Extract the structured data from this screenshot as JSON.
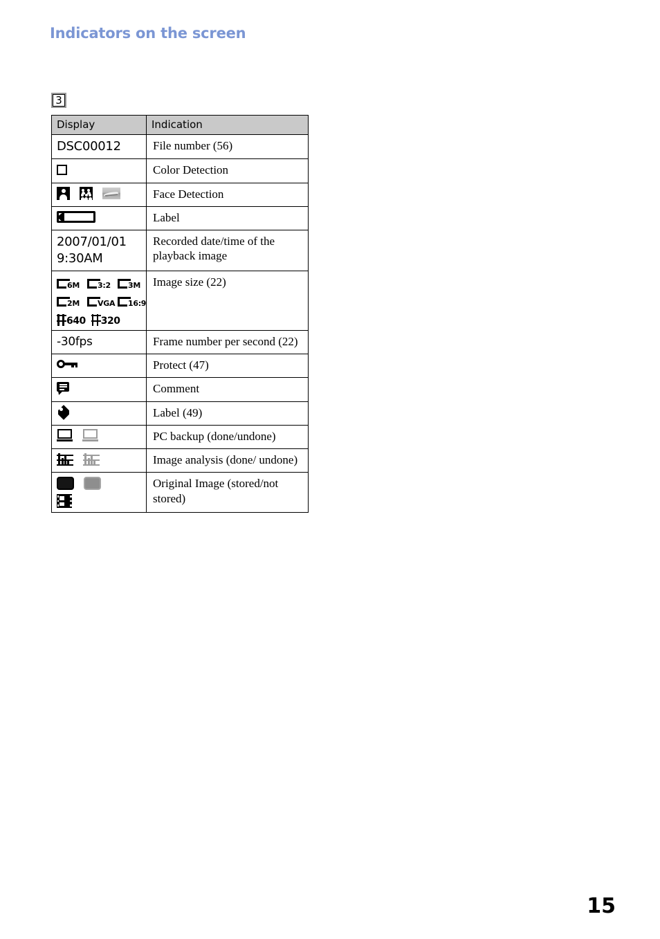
{
  "header": {
    "title": "Indicators on the screen"
  },
  "section": {
    "badge": "3"
  },
  "table": {
    "columns": [
      "Display",
      "Indication"
    ],
    "rows": [
      {
        "display_kind": "text",
        "display_text": "DSC00012",
        "indication": "File number (56)"
      },
      {
        "display_kind": "icons",
        "icons": [
          "color-detection-square-icon"
        ],
        "indication": "Color Detection"
      },
      {
        "display_kind": "icons",
        "icons": [
          "face-single-icon",
          "face-group-icon",
          "landscape-thumbnail-icon"
        ],
        "indication": "Face Detection"
      },
      {
        "display_kind": "icons",
        "icons": [
          "label-bar-icon"
        ],
        "indication": "Label"
      },
      {
        "display_kind": "text",
        "display_text": "2007/01/01\n9:30AM",
        "indication": "Recorded date/time of the playback image"
      },
      {
        "display_kind": "sizes",
        "sizes": [
          "6M",
          "3:2",
          "3M",
          "2M",
          "VGA",
          "16:9"
        ],
        "movie_sizes": [
          "640",
          "320"
        ],
        "indication": "Image size (22)"
      },
      {
        "display_kind": "text",
        "display_text": "-30fps",
        "indication": "Frame number per second (22)"
      },
      {
        "display_kind": "icons",
        "icons": [
          "key-icon"
        ],
        "indication": "Protect (47)"
      },
      {
        "display_kind": "icons",
        "icons": [
          "comment-bubble-icon"
        ],
        "indication": "Comment"
      },
      {
        "display_kind": "icons",
        "icons": [
          "tag-icon"
        ],
        "indication": "Label (49)"
      },
      {
        "display_kind": "icons",
        "icons": [
          "monitor-done-icon",
          "monitor-undone-icon"
        ],
        "indication": "PC backup (done/undone)"
      },
      {
        "display_kind": "icons",
        "icons": [
          "histogram-done-icon",
          "histogram-undone-icon"
        ],
        "indication": "Image analysis (done/ undone)"
      },
      {
        "display_kind": "icons",
        "icons": [
          "frame-stored-icon",
          "frame-not-stored-icon",
          "film-strip-icon"
        ],
        "indication": "Original Image (stored/not stored)"
      }
    ]
  },
  "footer": {
    "page_number": "15"
  },
  "colors": {
    "header_blue": "#7b96d4",
    "table_head_gray": "#c9c9c9",
    "icon_black": "#000000",
    "icon_gray": "#9d9d9d"
  }
}
